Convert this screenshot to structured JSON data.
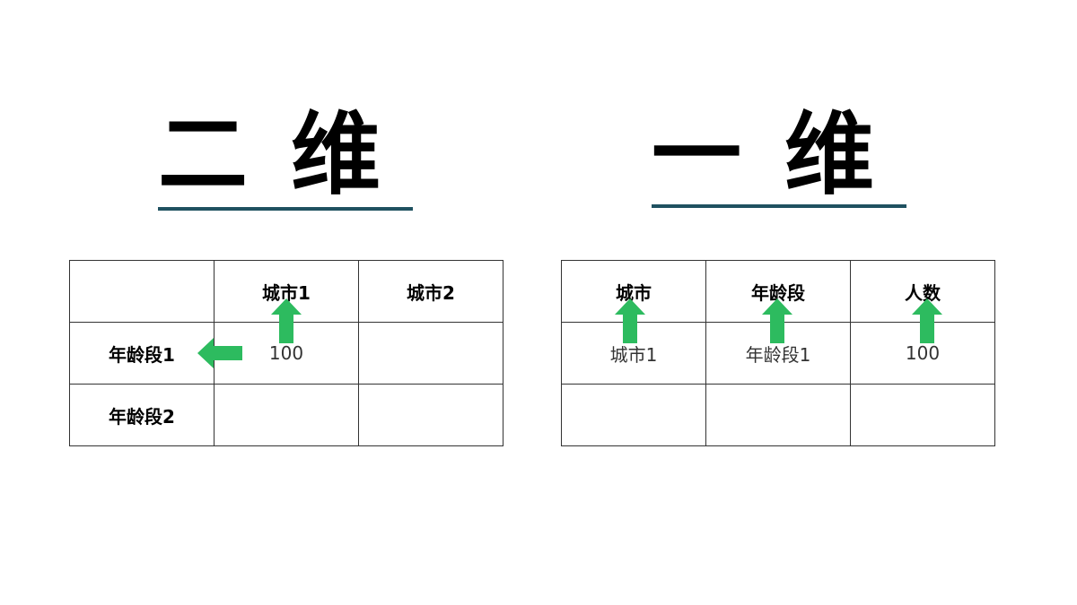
{
  "titles": {
    "left": "二维",
    "right": "一维"
  },
  "left_table": {
    "header": [
      "",
      "城市1",
      "城市2"
    ],
    "rows": [
      [
        "年龄段1",
        "100",
        ""
      ],
      [
        "年龄段2",
        "",
        ""
      ]
    ]
  },
  "right_table": {
    "header": [
      "城市",
      "年龄段",
      "人数"
    ],
    "rows": [
      [
        "城市1",
        "年龄段1",
        "100"
      ],
      [
        "",
        "",
        ""
      ]
    ]
  },
  "colors": {
    "accent_line": "#1f5160",
    "arrow": "#2dbb5f"
  },
  "icons": [
    "arrow-up-icon",
    "arrow-left-icon"
  ]
}
